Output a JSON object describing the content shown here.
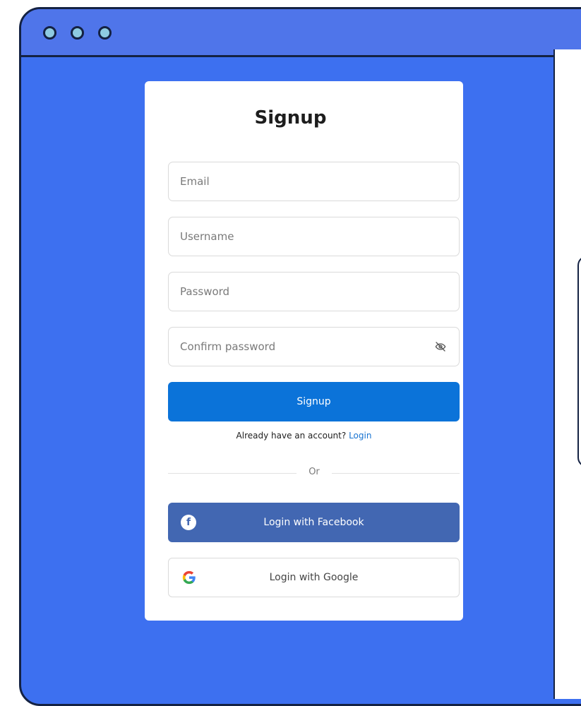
{
  "window": {
    "accent": "#3d70f0",
    "titlebar": "#4f75ea"
  },
  "signup": {
    "title": "Signup",
    "email_placeholder": "Email",
    "username_placeholder": "Username",
    "password_placeholder": "Password",
    "confirm_placeholder": "Confirm password",
    "button_label": "Signup",
    "button_color": "#0b73d9",
    "prompt_text": "Already have an account?",
    "login_link": "Login",
    "divider_text": "Or",
    "facebook_label": "Login with Facebook",
    "facebook_color": "#4267b2",
    "google_label": "Login with Google"
  },
  "icons": {
    "dots": [
      "window-dot-icon",
      "window-dot-icon",
      "window-dot-icon"
    ],
    "confirm_toggle": "eye-off-icon",
    "facebook": "facebook-icon",
    "google": "google-icon"
  }
}
